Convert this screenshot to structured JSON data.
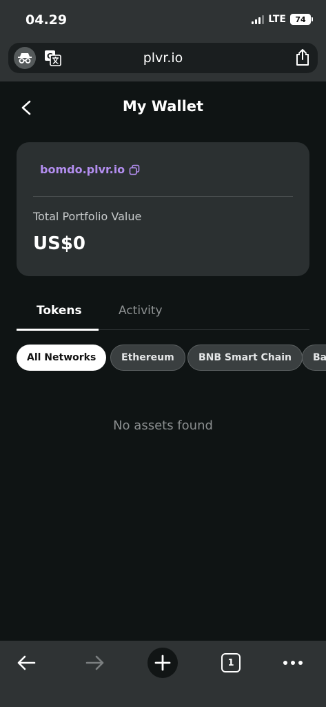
{
  "status_bar": {
    "time": "04.29",
    "network": "LTE",
    "battery": "74"
  },
  "browser": {
    "url": "plvr.io",
    "tab_count": "1"
  },
  "header": {
    "title": "My Wallet"
  },
  "wallet": {
    "address": "bomdo.plvr.io",
    "portfolio_label": "Total Portfolio Value",
    "portfolio_value": "US$0"
  },
  "tabs": [
    {
      "label": "Tokens",
      "active": true
    },
    {
      "label": "Activity",
      "active": false
    }
  ],
  "networks": [
    {
      "label": "All Networks",
      "active": true
    },
    {
      "label": "Ethereum",
      "active": false
    },
    {
      "label": "BNB Smart Chain",
      "active": false
    },
    {
      "label": "Bas",
      "active": false
    }
  ],
  "empty_state": "No assets found",
  "colors": {
    "background": "#0f1414",
    "card": "#2b3031",
    "accent": "#b38ef0",
    "chrome": "#2f3334"
  }
}
